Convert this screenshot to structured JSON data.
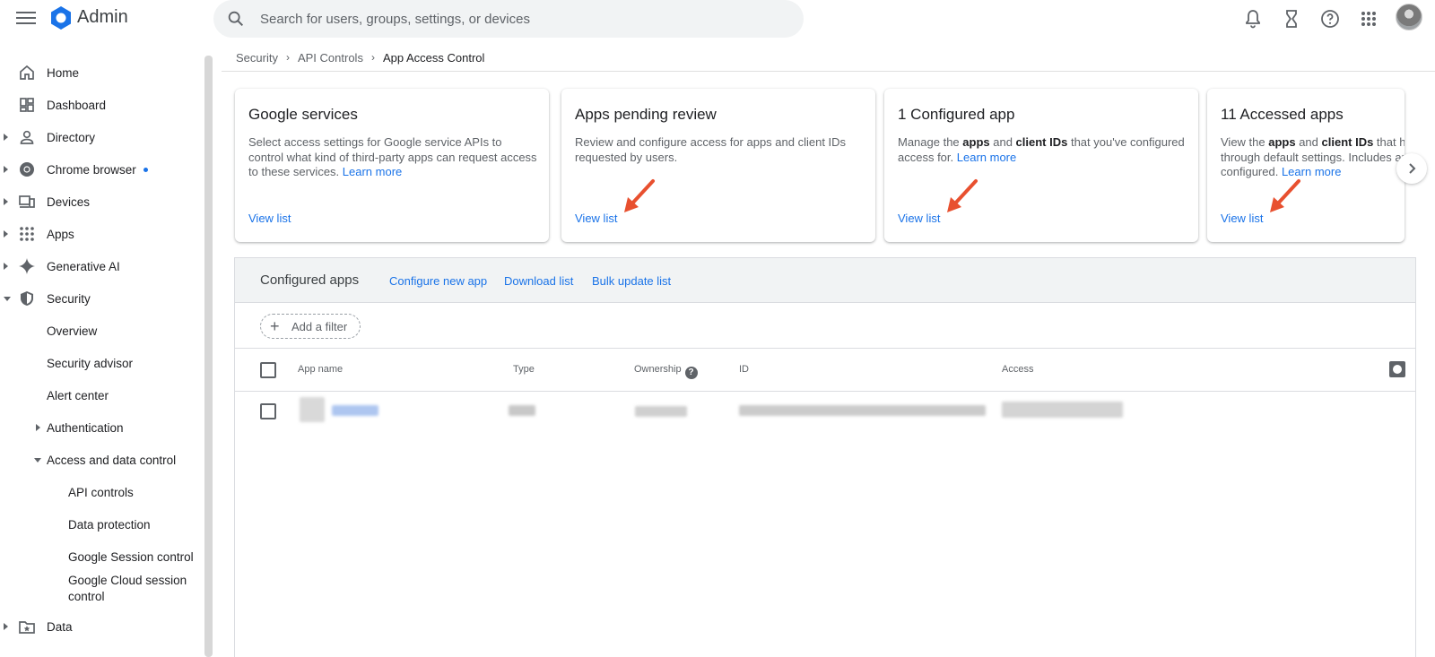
{
  "app": {
    "name": "Admin"
  },
  "search": {
    "placeholder": "Search for users, groups, settings, or devices"
  },
  "topbar": {
    "icons": [
      "notifications-icon",
      "hourglass-icon",
      "help-icon",
      "apps-grid-icon",
      "avatar"
    ]
  },
  "sidebar": {
    "items": [
      {
        "label": "Home",
        "icon": "home-icon"
      },
      {
        "label": "Dashboard",
        "icon": "dashboard-icon"
      },
      {
        "label": "Directory",
        "icon": "person-icon"
      },
      {
        "label": "Chrome browser",
        "icon": "chrome-icon"
      },
      {
        "label": "Devices",
        "icon": "devices-icon"
      },
      {
        "label": "Apps",
        "icon": "apps-grid-icon"
      },
      {
        "label": "Generative AI",
        "icon": "sparkle-icon"
      },
      {
        "label": "Security",
        "icon": "shield-icon"
      },
      {
        "label": "Overview"
      },
      {
        "label": "Security advisor"
      },
      {
        "label": "Alert center"
      },
      {
        "label": "Authentication"
      },
      {
        "label": "Access and data control"
      },
      {
        "label": "API controls"
      },
      {
        "label": "Data protection"
      },
      {
        "label": "Google Session control"
      },
      {
        "label": "Google Cloud session control"
      },
      {
        "label": "Data",
        "icon": "folder-star-icon"
      }
    ]
  },
  "breadcrumb": {
    "items": [
      "Security",
      "API Controls",
      "App Access Control"
    ]
  },
  "cards": [
    {
      "title": "Google services",
      "desc": "Select access settings for Google service APIs to control what kind of third-party apps can request access to these services.",
      "learn_more": "Learn more",
      "view": "View list"
    },
    {
      "title": "Apps pending review",
      "desc": "Review and configure access for apps and client IDs requested by users.",
      "view": "View list"
    },
    {
      "title": "1 Configured app",
      "desc_1": "Manage the ",
      "desc_b1": "apps",
      "desc_2": " and ",
      "desc_b2": "client IDs",
      "desc_3": " that you've configured access for.",
      "learn_more": "Learn more",
      "view": "View list"
    },
    {
      "title": "11 Accessed apps",
      "desc_1": "View the ",
      "desc_b1": "apps",
      "desc_2": " and ",
      "desc_b2": "client IDs",
      "desc_3": " that have accessed data through default settings. Includes apps that have configured.",
      "learn_more": "Learn more",
      "view": "View list"
    }
  ],
  "colors": {
    "accent": "#1a73e8",
    "arrow": "#e8502f"
  },
  "panel": {
    "title": "Configured apps",
    "actions": [
      "Configure new app",
      "Download list",
      "Bulk update list"
    ],
    "filter": "Add a filter",
    "columns": [
      "App name",
      "Type",
      "Ownership",
      "ID",
      "Access"
    ]
  }
}
